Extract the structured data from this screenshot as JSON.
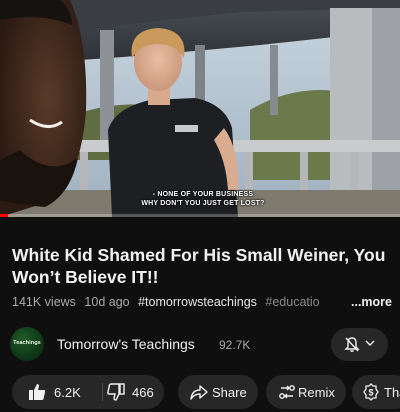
{
  "video": {
    "caption_line1": "- NONE OF YOUR BUSINESS",
    "caption_line2": "WHY DON'T YOU JUST GET LOST?",
    "shirt_text": "",
    "progress": 0.02
  },
  "title": "White Kid Shamed For His Small Weiner, You Won’t Believe IT!!",
  "meta": {
    "views": "141K views",
    "age": "10d ago",
    "tag1": "#tomorrowsteachings",
    "tag2": "#educatio",
    "more": "...more"
  },
  "channel": {
    "avatar_text": "Teachings",
    "name": "Tomorrow's Teachings",
    "subscribers": "92.7K",
    "bell_icon": "bell-off-icon",
    "chevron_icon": "chevron-down-icon"
  },
  "actions": {
    "likes": "6.2K",
    "dislikes": "466",
    "share": "Share",
    "remix": "Remix",
    "thanks": "Tha"
  }
}
